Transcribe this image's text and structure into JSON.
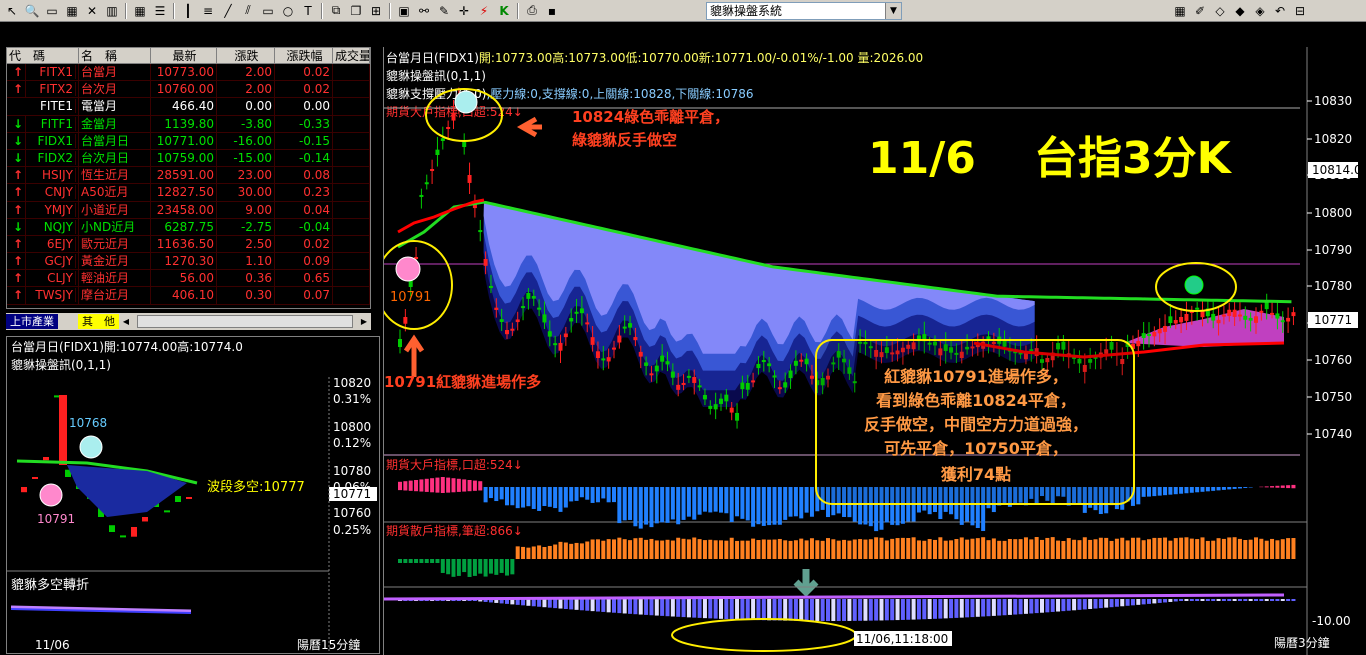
{
  "app": {
    "system_name": "貔貅操盤系統"
  },
  "toolbar": {
    "icons": [
      "cursor-icon",
      "zoom-icon",
      "window-icon",
      "grid-icon",
      "close-icon",
      "bars-icon",
      "columns-icon",
      "list-icon",
      "candles-icon",
      "lines-icon",
      "trend-icon",
      "fibonacci-icon",
      "rect-icon",
      "circle-icon",
      "text-icon",
      "copy-icon",
      "layers-icon",
      "table-icon",
      "image-icon",
      "link-icon",
      "pen-icon",
      "cross-icon",
      "bolt-icon",
      "k-icon",
      "print-icon",
      "save-icon"
    ]
  },
  "quote_table": {
    "headers": [
      "代　碼",
      "名　稱",
      "最新",
      "漲跌",
      "漲跌幅",
      "成交量"
    ],
    "rows": [
      {
        "arrow": "up",
        "code": "FITX1",
        "name": "台當月",
        "last": "10773.00",
        "chg": "2.00",
        "pct": "0.02",
        "color": "red"
      },
      {
        "arrow": "up",
        "code": "FITX2",
        "name": "台次月",
        "last": "10760.00",
        "chg": "2.00",
        "pct": "0.02",
        "color": "red"
      },
      {
        "arrow": "",
        "code": "FITE1",
        "name": "電當月",
        "last": "466.40",
        "chg": "0.00",
        "pct": "0.00",
        "color": "white"
      },
      {
        "arrow": "down",
        "code": "FITF1",
        "name": "金當月",
        "last": "1139.80",
        "chg": "-3.80",
        "pct": "-0.33",
        "color": "green"
      },
      {
        "arrow": "down",
        "code": "FIDX1",
        "name": "台當月日",
        "last": "10771.00",
        "chg": "-16.00",
        "pct": "-0.15",
        "color": "green"
      },
      {
        "arrow": "down",
        "code": "FIDX2",
        "name": "台次月日",
        "last": "10759.00",
        "chg": "-15.00",
        "pct": "-0.14",
        "color": "green"
      },
      {
        "arrow": "up",
        "code": "HSIJY",
        "name": "恆生近月",
        "last": "28591.00",
        "chg": "23.00",
        "pct": "0.08",
        "color": "red"
      },
      {
        "arrow": "up",
        "code": "CNJY",
        "name": "A50近月",
        "last": "12827.50",
        "chg": "30.00",
        "pct": "0.23",
        "color": "red"
      },
      {
        "arrow": "up",
        "code": "YMJY",
        "name": "小道近月",
        "last": "23458.00",
        "chg": "9.00",
        "pct": "0.04",
        "color": "red"
      },
      {
        "arrow": "down",
        "code": "NQJY",
        "name": "小ND近月",
        "last": "6287.75",
        "chg": "-2.75",
        "pct": "-0.04",
        "color": "green"
      },
      {
        "arrow": "up",
        "code": "6EJY",
        "name": "歐元近月",
        "last": "11636.50",
        "chg": "2.50",
        "pct": "0.02",
        "color": "red"
      },
      {
        "arrow": "up",
        "code": "GCJY",
        "name": "黃金近月",
        "last": "1270.30",
        "chg": "1.10",
        "pct": "0.09",
        "color": "red"
      },
      {
        "arrow": "up",
        "code": "CLJY",
        "name": "輕油近月",
        "last": "56.00",
        "chg": "0.36",
        "pct": "0.65",
        "color": "red"
      },
      {
        "arrow": "up",
        "code": "TWSJY",
        "name": "摩台近月",
        "last": "406.10",
        "chg": "0.30",
        "pct": "0.07",
        "color": "red"
      }
    ],
    "tab_market": "上市產業",
    "tab_other": "其　他"
  },
  "small_chart": {
    "header": "台當月日(FIDX1)開:10774.00高:10774.0",
    "indicator": "貔貅操盤訊(0,1,1)",
    "price_labels": [
      "10820",
      "10800",
      "10780",
      "10760"
    ],
    "pct_labels": [
      "0.31%",
      "0.12%",
      "0.06%",
      "0.25%"
    ],
    "current_tag": "10771",
    "mark_high": "10768",
    "mark_low": "10791",
    "wave_label": "波段多空:10777",
    "sub_title": "貔貅多空轉折",
    "date": "11/06",
    "footer": "陽曆15分鐘"
  },
  "main_chart": {
    "header_name": "台當月日(FIDX1)",
    "header_values": "開:10773.00高:10773.00低:10770.00新:10771.00/-0.01%/-1.00 量:2026.00",
    "indicator_1": "貔貅操盤訊(0,1,1)",
    "indicator_2_name": "貔貅支撐壓力(1,0)",
    "indicator_2_values": ",壓力線:0,支撐線:0,上關線:10828,下關線:10786",
    "indicator_3": "期貨大戶指標,口超:524↓",
    "price_axis": [
      "10830",
      "10820",
      "10810",
      "10800",
      "10790",
      "10780",
      "10770",
      "10760",
      "10750",
      "10740"
    ],
    "current_tag": "10814.0",
    "current_tag2": "10771",
    "big_title_date": "11/6",
    "big_title_text": "台指3分K",
    "note_top_line1": "10824綠色乖離平倉，",
    "note_top_line2": "綠貔貅反手做空",
    "mark_low_price": "10791",
    "note_entry": "10791紅貔貅進場作多",
    "note_box": [
      "紅貔貅10791進場作多，",
      "看到綠色乖離10824平倉，",
      "反手做空，中間空方力道過強，",
      "可先平倉，10750平倉，",
      "獲利74點"
    ],
    "panel2_title": "期貨大戶指標,口超:524↓",
    "panel3_title": "期貨散戶指標,筆超:866↓",
    "panel4_axis": "-10.00",
    "timestamp": "11/06,11:18:00",
    "footer": "陽曆3分鐘",
    "colors": {
      "up": "#ff2020",
      "down": "#00cc00",
      "ma_red": "#ff0000",
      "ma_green": "#22dd22",
      "note": "#ff6600",
      "title": "#ffff00"
    }
  }
}
